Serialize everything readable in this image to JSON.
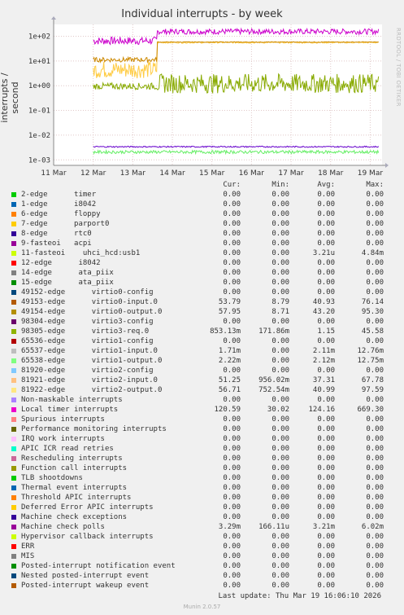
{
  "chart_data": {
    "type": "line",
    "title": "Individual interrupts - by week",
    "ylabel": "interrupts / second",
    "side_label": "RRDTOOL / TOBI OETIKER",
    "y_scale": "log",
    "ylim": [
      0.0006,
      300
    ],
    "y_ticks": [
      {
        "value": 100,
        "label": "1e+02"
      },
      {
        "value": 10,
        "label": "1e+01"
      },
      {
        "value": 1,
        "label": "1e+00"
      },
      {
        "value": 0.1,
        "label": "1e-01"
      },
      {
        "value": 0.01,
        "label": "1e-02"
      },
      {
        "value": 0.001,
        "label": "1e-03"
      }
    ],
    "x_ticks": [
      "11 Mar",
      "12 Mar",
      "13 Mar",
      "14 Mar",
      "15 Mar",
      "16 Mar",
      "17 Mar",
      "18 Mar",
      "19 Mar"
    ],
    "x_range_days": [
      0,
      8.3
    ],
    "data_start_day": 1.0,
    "change_day": 2.62,
    "series": [
      {
        "name": "Local timer interrupts",
        "color": "#cc00cc",
        "before": [
          45,
          95
        ],
        "after": [
          120,
          200
        ]
      },
      {
        "name": "virtio2-output.0",
        "color": "#ffcc44",
        "before": [
          2,
          10
        ],
        "after": [
          52,
          60
        ]
      },
      {
        "name": "virtio0-output.0",
        "color": "#cc8800",
        "before": [
          9,
          14
        ],
        "after": [
          56,
          60
        ]
      },
      {
        "name": "virtio3-req.0",
        "color": "#88aa00",
        "before": [
          0.7,
          1.3
        ],
        "after": [
          0.5,
          3.0
        ]
      },
      {
        "name": "Machine check polls",
        "color": "#6600cc",
        "before": [
          0.0032,
          0.0036
        ],
        "after": [
          0.0032,
          0.0036
        ]
      },
      {
        "name": "virtio1-output.0",
        "color": "#66ee66",
        "before": [
          0.0018,
          0.0024
        ],
        "after": [
          0.0018,
          0.0024
        ]
      }
    ]
  },
  "table": {
    "headers": [
      "Cur:",
      "Min:",
      "Avg:",
      "Max:"
    ],
    "rows": [
      {
        "label": "2-edge      timer",
        "color": "#00cc00",
        "cur": "0.00",
        "min": "0.00",
        "avg": "0.00",
        "max": "0.00"
      },
      {
        "label": "1-edge      i8042",
        "color": "#0066b3",
        "cur": "0.00",
        "min": "0.00",
        "avg": "0.00",
        "max": "0.00"
      },
      {
        "label": "6-edge      floppy",
        "color": "#ff8000",
        "cur": "0.00",
        "min": "0.00",
        "avg": "0.00",
        "max": "0.00"
      },
      {
        "label": "7-edge      parport0",
        "color": "#ffcc00",
        "cur": "0.00",
        "min": "0.00",
        "avg": "0.00",
        "max": "0.00"
      },
      {
        "label": "8-edge      rtc0",
        "color": "#330099",
        "cur": "0.00",
        "min": "0.00",
        "avg": "0.00",
        "max": "0.00"
      },
      {
        "label": "9-fasteoi   acpi",
        "color": "#990099",
        "cur": "0.00",
        "min": "0.00",
        "avg": "0.00",
        "max": "0.00"
      },
      {
        "label": "11-fasteoi    uhci_hcd:usb1",
        "color": "#ccff00",
        "cur": "0.00",
        "min": "0.00",
        "avg": "3.21u",
        "max": "4.84m"
      },
      {
        "label": "12-edge      i8042",
        "color": "#ff0000",
        "cur": "0.00",
        "min": "0.00",
        "avg": "0.00",
        "max": "0.00"
      },
      {
        "label": "14-edge      ata_piix",
        "color": "#808080",
        "cur": "0.00",
        "min": "0.00",
        "avg": "0.00",
        "max": "0.00"
      },
      {
        "label": "15-edge      ata_piix",
        "color": "#008f00",
        "cur": "0.00",
        "min": "0.00",
        "avg": "0.00",
        "max": "0.00"
      },
      {
        "label": "49152-edge      virtio0-config",
        "color": "#00487d",
        "cur": "0.00",
        "min": "0.00",
        "avg": "0.00",
        "max": "0.00"
      },
      {
        "label": "49153-edge      virtio0-input.0",
        "color": "#b35a00",
        "cur": "53.79",
        "min": "8.79",
        "avg": "40.93",
        "max": "76.14"
      },
      {
        "label": "49154-edge      virtio0-output.0",
        "color": "#b38f00",
        "cur": "57.95",
        "min": "8.71",
        "avg": "43.20",
        "max": "95.30"
      },
      {
        "label": "98304-edge      virtio3-config",
        "color": "#6b006b",
        "cur": "0.00",
        "min": "0.00",
        "avg": "0.00",
        "max": "0.00"
      },
      {
        "label": "98305-edge      virtio3-req.0",
        "color": "#8fb300",
        "cur": "853.13m",
        "min": "171.86m",
        "avg": "1.15",
        "max": "45.58"
      },
      {
        "label": "65536-edge      virtio1-config",
        "color": "#b30000",
        "cur": "0.00",
        "min": "0.00",
        "avg": "0.00",
        "max": "0.00"
      },
      {
        "label": "65537-edge      virtio1-input.0",
        "color": "#bebebe",
        "cur": "1.71m",
        "min": "0.00",
        "avg": "2.11m",
        "max": "12.76m"
      },
      {
        "label": "65538-edge      virtio1-output.0",
        "color": "#80ff80",
        "cur": "2.22m",
        "min": "0.00",
        "avg": "2.12m",
        "max": "12.75m"
      },
      {
        "label": "81920-edge      virtio2-config",
        "color": "#80c9ff",
        "cur": "0.00",
        "min": "0.00",
        "avg": "0.00",
        "max": "0.00"
      },
      {
        "label": "81921-edge      virtio2-input.0",
        "color": "#ffc080",
        "cur": "51.25",
        "min": "956.02m",
        "avg": "37.31",
        "max": "67.78"
      },
      {
        "label": "81922-edge      virtio2-output.0",
        "color": "#ffe680",
        "cur": "56.71",
        "min": "752.54m",
        "avg": "40.99",
        "max": "97.59"
      },
      {
        "label": "Non-maskable interrupts",
        "color": "#aa80ff",
        "cur": "0.00",
        "min": "0.00",
        "avg": "0.00",
        "max": "0.00"
      },
      {
        "label": "Local timer interrupts",
        "color": "#ee00cc",
        "cur": "120.59",
        "min": "30.02",
        "avg": "124.16",
        "max": "669.30"
      },
      {
        "label": "Spurious interrupts",
        "color": "#ff8080",
        "cur": "0.00",
        "min": "0.00",
        "avg": "0.00",
        "max": "0.00"
      },
      {
        "label": "Performance monitoring interrupts",
        "color": "#666600",
        "cur": "0.00",
        "min": "0.00",
        "avg": "0.00",
        "max": "0.00"
      },
      {
        "label": "IRQ work interrupts",
        "color": "#ffbfff",
        "cur": "0.00",
        "min": "0.00",
        "avg": "0.00",
        "max": "0.00"
      },
      {
        "label": "APIC ICR read retries",
        "color": "#00ffcc",
        "cur": "0.00",
        "min": "0.00",
        "avg": "0.00",
        "max": "0.00"
      },
      {
        "label": "Rescheduling interrupts",
        "color": "#cc6699",
        "cur": "0.00",
        "min": "0.00",
        "avg": "0.00",
        "max": "0.00"
      },
      {
        "label": "Function call interrupts",
        "color": "#999900",
        "cur": "0.00",
        "min": "0.00",
        "avg": "0.00",
        "max": "0.00"
      },
      {
        "label": "TLB shootdowns",
        "color": "#00cc00",
        "cur": "0.00",
        "min": "0.00",
        "avg": "0.00",
        "max": "0.00"
      },
      {
        "label": "Thermal event interrupts",
        "color": "#0066b3",
        "cur": "0.00",
        "min": "0.00",
        "avg": "0.00",
        "max": "0.00"
      },
      {
        "label": "Threshold APIC interrupts",
        "color": "#ff8000",
        "cur": "0.00",
        "min": "0.00",
        "avg": "0.00",
        "max": "0.00"
      },
      {
        "label": "Deferred Error APIC interrupts",
        "color": "#ffcc00",
        "cur": "0.00",
        "min": "0.00",
        "avg": "0.00",
        "max": "0.00"
      },
      {
        "label": "Machine check exceptions",
        "color": "#330099",
        "cur": "0.00",
        "min": "0.00",
        "avg": "0.00",
        "max": "0.00"
      },
      {
        "label": "Machine check polls",
        "color": "#990099",
        "cur": "3.29m",
        "min": "166.11u",
        "avg": "3.21m",
        "max": "6.02m"
      },
      {
        "label": "Hypervisor callback interrupts",
        "color": "#ccff00",
        "cur": "0.00",
        "min": "0.00",
        "avg": "0.00",
        "max": "0.00"
      },
      {
        "label": "ERR",
        "color": "#ff0000",
        "cur": "0.00",
        "min": "0.00",
        "avg": "0.00",
        "max": "0.00"
      },
      {
        "label": "MIS",
        "color": "#808080",
        "cur": "0.00",
        "min": "0.00",
        "avg": "0.00",
        "max": "0.00"
      },
      {
        "label": "Posted-interrupt notification event",
        "color": "#008f00",
        "cur": "0.00",
        "min": "0.00",
        "avg": "0.00",
        "max": "0.00"
      },
      {
        "label": "Nested posted-interrupt event",
        "color": "#00487d",
        "cur": "0.00",
        "min": "0.00",
        "avg": "0.00",
        "max": "0.00"
      },
      {
        "label": "Posted-interrupt wakeup event",
        "color": "#b35a00",
        "cur": "0.00",
        "min": "0.00",
        "avg": "0.00",
        "max": "0.00"
      }
    ]
  },
  "footer": {
    "last_update": "Last update: Thu Mar 19 16:06:10 2026",
    "version": "Munin 2.0.57"
  }
}
